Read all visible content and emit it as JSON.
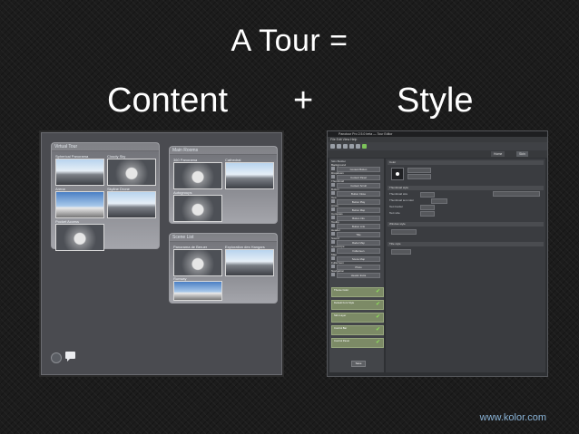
{
  "slide": {
    "title": "A Tour =",
    "content_label": "Content",
    "plus": "+",
    "style_label": "Style",
    "footer": "www.kolor.com"
  },
  "content_panel": {
    "groups": [
      {
        "title": "Virtual Tour",
        "thumbs": [
          "Spherical Panorama",
          "Cloudy Sky",
          "Arena",
          "Skyline Drone",
          "Pocket Access"
        ]
      },
      {
        "title": "Main Rooms",
        "thumbs": [
          "360 Panorama",
          "Cathedral"
        ],
        "subtitle": "Autogroups"
      },
      {
        "title": "Scene List",
        "thumbs": [
          "Panorama de Beruer",
          "Exploration des Hangars",
          "Runway"
        ]
      }
    ],
    "icons": [
      "camera-icon",
      "chat-icon"
    ]
  },
  "style_panel": {
    "window_title": "Panotour Pro 2.5.0 beta — Tour Editor",
    "menu": "File  Edit  View  Help",
    "tabs": [
      "Home",
      "Skin"
    ],
    "left_section_label": "Skin Builder",
    "left_items": [
      {
        "label": "Background",
        "value": "Content Button"
      },
      {
        "label": "Dropdown",
        "value": "Content Panel"
      },
      {
        "label": "Thumbnail",
        "value": "Content Scroll"
      },
      {
        "label": "Button",
        "value": "Button Close"
      },
      {
        "label": "Text",
        "value": "Button Play"
      },
      {
        "label": "Arrow",
        "value": "Button Map"
      },
      {
        "label": "Compass",
        "value": "Button Info"
      },
      {
        "label": "Tooltip",
        "value": "Button Link"
      },
      {
        "label": "Header",
        "value": "Title"
      },
      {
        "label": "Sound",
        "value": "Radar Map"
      },
      {
        "label": "Gyroscope",
        "value": "Fullscreen"
      },
      {
        "label": "Map",
        "value": "Scene Map"
      },
      {
        "label": "Fullscreen",
        "value": "Photo"
      },
      {
        "label": "Navigation",
        "value": "Header Extra"
      }
    ],
    "grouped_items": [
      {
        "label": "Theme Color",
        "checked": true
      },
      {
        "label": "Default Font Style",
        "checked": true
      },
      {
        "label": "Skin Layer",
        "checked": true
      },
      {
        "label": "Control Bar",
        "checked": true
      },
      {
        "label": "Control Panel",
        "checked": true
      }
    ],
    "main_sections": [
      "Color",
      "Thumbnail style",
      "Window style",
      "Title style"
    ],
    "fields": [
      "Thumbnail size",
      "Thumbnail text color",
      "Text border",
      "Text size"
    ],
    "ok_label": "Save"
  }
}
